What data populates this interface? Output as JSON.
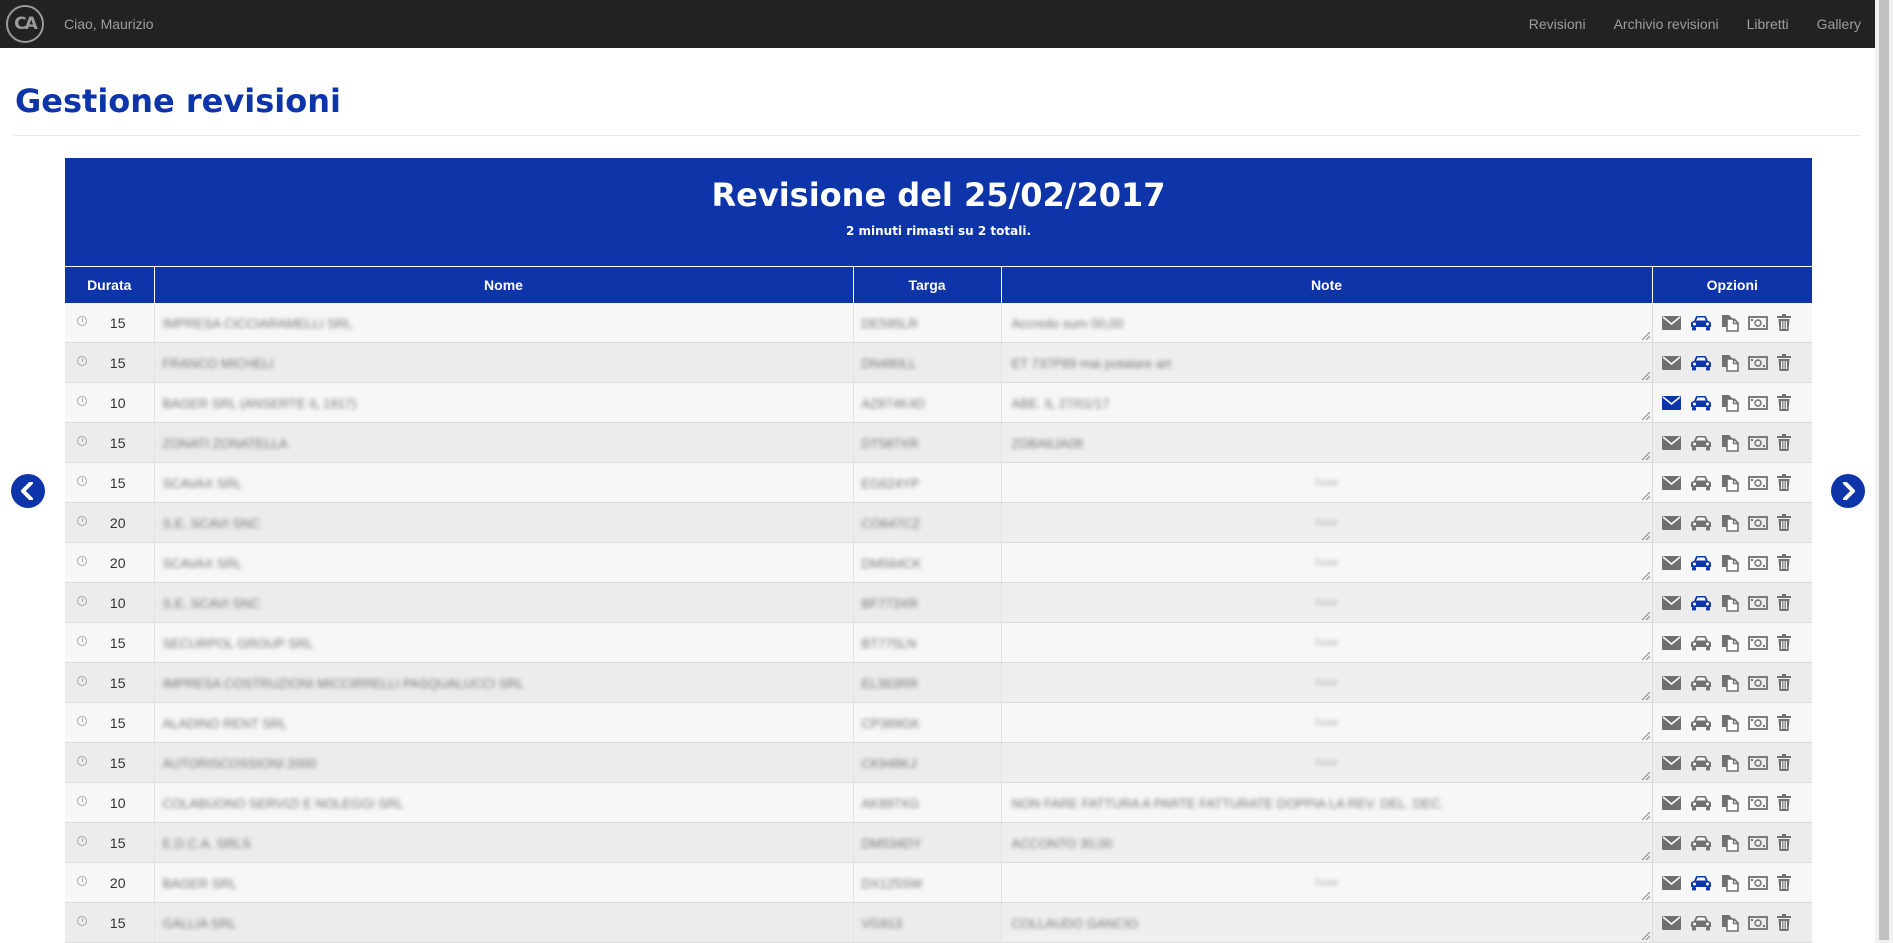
{
  "navbar": {
    "logo_text": "CA",
    "greeting": "Ciao, Maurizio",
    "links": [
      "Revisioni",
      "Archivio revisioni",
      "Libretti",
      "Gallery"
    ]
  },
  "page": {
    "title": "Gestione revisioni"
  },
  "panel": {
    "title": "Revisione del 25/02/2017",
    "subtitle": "2 minuti rimasti su 2 totali."
  },
  "table": {
    "headers": {
      "durata": "Durata",
      "nome": "Nome",
      "targa": "Targa",
      "note": "Note",
      "opzioni": "Opzioni"
    },
    "note_placeholder": "Note",
    "rows": [
      {
        "durata": "15",
        "nome": "IMPRESA CICCIARAMELLI SRL",
        "targa": "DE595LR",
        "note": "Accredo sum 00,00",
        "mail_active": false,
        "car_active": true
      },
      {
        "durata": "15",
        "nome": "FRANCO MICHELI",
        "targa": "DN480LL",
        "note": "ET 737P89 mai potatare art",
        "mail_active": false,
        "car_active": true
      },
      {
        "durata": "10",
        "nome": "BAGER SRL (ANSERTE IL 1917)",
        "targa": "AZ874K4D",
        "note": "ABE. IL 27/01/17",
        "mail_active": true,
        "car_active": true
      },
      {
        "durata": "15",
        "nome": "ZONATI ZONATELLA",
        "targa": "DT587XR",
        "note": "ZDBA6JA08",
        "mail_active": false,
        "car_active": false
      },
      {
        "durata": "15",
        "nome": "SCAVAX SRL",
        "targa": "EG624YP",
        "note": "",
        "mail_active": false,
        "car_active": false
      },
      {
        "durata": "20",
        "nome": "S.E. SCAVI SNC",
        "targa": "CO647CZ",
        "note": "",
        "mail_active": false,
        "car_active": false
      },
      {
        "durata": "20",
        "nome": "SCAVAX SRL",
        "targa": "DM564CK",
        "note": "",
        "mail_active": false,
        "car_active": true
      },
      {
        "durata": "10",
        "nome": "S.E. SCAVI SNC",
        "targa": "BF773XR",
        "note": "",
        "mail_active": false,
        "car_active": true
      },
      {
        "durata": "15",
        "nome": "SECURPOL GROUP SRL",
        "targa": "BT775LN",
        "note": "",
        "mail_active": false,
        "car_active": false
      },
      {
        "durata": "15",
        "nome": "IMPRESA COSTRUZIONI MICCIRRELLI PASQUALUCCI SRL",
        "targa": "EL363RR",
        "note": "",
        "mail_active": false,
        "car_active": false
      },
      {
        "durata": "15",
        "nome": "ALADINO RENT SRL",
        "targa": "CP389GK",
        "note": "",
        "mail_active": false,
        "car_active": false
      },
      {
        "durata": "15",
        "nome": "AUTORISCOSSIONI 2000",
        "targa": "CK948KJ",
        "note": "",
        "mail_active": false,
        "car_active": false
      },
      {
        "durata": "10",
        "nome": "COLABUONO SERVIZI E NOLEGGI SRL",
        "targa": "AK897XG",
        "note": "NON FARE FATTURA A PARTE FATTURATE DOPPIA LA REV. DEL. DEC.",
        "mail_active": false,
        "car_active": false
      },
      {
        "durata": "15",
        "nome": "E.D.C.A. SRLS",
        "targa": "DM534DY",
        "note": "ACCONTO 30,00",
        "mail_active": false,
        "car_active": false
      },
      {
        "durata": "20",
        "nome": "BAGER SRL",
        "targa": "DX125SW",
        "note": "",
        "mail_active": false,
        "car_active": true
      },
      {
        "durata": "15",
        "nome": "GALLIA SRL",
        "targa": "VG913",
        "note": "COLLAUDO GANCIO",
        "mail_active": false,
        "car_active": false
      }
    ]
  },
  "icons": {
    "options": [
      "envelope-icon",
      "car-icon",
      "copy-icon",
      "money-icon",
      "trash-icon"
    ],
    "arrow_left": "chevron-left-icon",
    "arrow_right": "chevron-right-icon",
    "clock": "clock-icon"
  },
  "colors": {
    "brand": "#0d34a8",
    "navbar": "#222222",
    "icon_inactive": "#707070"
  }
}
